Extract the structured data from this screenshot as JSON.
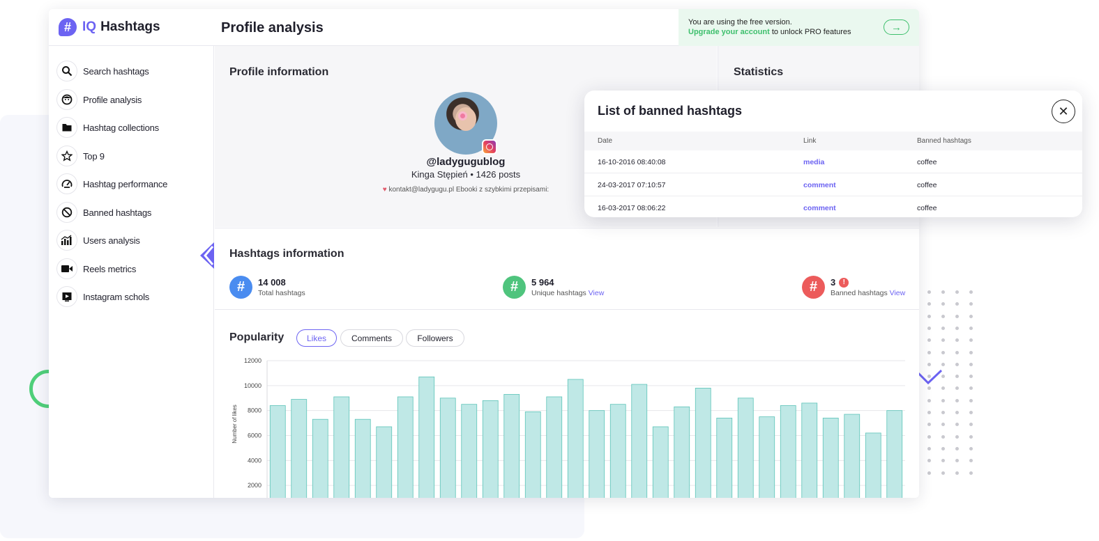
{
  "app": {
    "brand_iq": "IQ",
    "brand_name": "Hashtags",
    "page_title": "Profile analysis",
    "banner": {
      "line1": "You are using the free version.",
      "link": "Upgrade your account",
      "line2_rest": "to unlock PRO features"
    }
  },
  "sidebar": {
    "items": [
      {
        "label": "Search hashtags",
        "icon": "search-icon"
      },
      {
        "label": "Profile analysis",
        "icon": "face-icon"
      },
      {
        "label": "Hashtag collections",
        "icon": "folder-icon"
      },
      {
        "label": "Top 9",
        "icon": "star-icon"
      },
      {
        "label": "Hashtag performance",
        "icon": "gauge-icon"
      },
      {
        "label": "Banned hashtags",
        "icon": "ban-icon"
      },
      {
        "label": "Users analysis",
        "icon": "bar-chart-icon"
      },
      {
        "label": "Reels metrics",
        "icon": "video-camera-icon"
      },
      {
        "label": "Instagram schols",
        "icon": "play-box-icon"
      }
    ]
  },
  "profile": {
    "section_title": "Profile information",
    "handle": "@ladygugublog",
    "subline": "Kinga Stępień • 1426 posts",
    "bio": "kontakt@ladygugu.pl Ebooki z szybkimi przepisami:"
  },
  "statistics": {
    "section_title": "Statistics"
  },
  "hashtags_info": {
    "section_title": "Hashtags information",
    "total": {
      "value": "14 008",
      "caption": "Total hashtags",
      "color": "#4a8cf0"
    },
    "unique": {
      "value": "5 964",
      "caption": "Unique hashtags",
      "view": "View",
      "color": "#4fc47d"
    },
    "banned": {
      "value": "3",
      "caption": "Banned hashtags",
      "view": "View",
      "color": "#ec5b5b"
    }
  },
  "popularity": {
    "section_title": "Popularity",
    "tabs": [
      "Likes",
      "Comments",
      "Followers"
    ],
    "active_tab": "Likes"
  },
  "chart_data": {
    "type": "bar",
    "title": "",
    "xlabel": "",
    "ylabel": "Number of likes",
    "ylim": [
      0,
      12000
    ],
    "yticks": [
      2000,
      4000,
      6000,
      8000,
      10000,
      12000
    ],
    "values": [
      8400,
      8900,
      7300,
      9100,
      7300,
      6700,
      9100,
      10700,
      9000,
      8500,
      8800,
      9300,
      7900,
      9100,
      10500,
      8000,
      8500,
      10100,
      6700,
      8300,
      9800,
      7400,
      9000,
      7500,
      8400,
      8600,
      7400,
      7700,
      6200,
      8000
    ],
    "bar_color": "#bfe8e6",
    "bar_stroke": "#5cc3b8",
    "grid": true
  },
  "banned_modal": {
    "title": "List of banned hashtags",
    "columns": [
      "Date",
      "Link",
      "Banned hashtags"
    ],
    "rows": [
      {
        "date": "16-10-2016 08:40:08",
        "link": "media",
        "hashtag": "coffee"
      },
      {
        "date": "24-03-2017 07:10:57",
        "link": "comment",
        "hashtag": "coffee"
      },
      {
        "date": "16-03-2017 08:06:22",
        "link": "comment",
        "hashtag": "coffee"
      }
    ]
  },
  "colors": {
    "accent": "#6c63f2",
    "green": "#3dbf6c",
    "red": "#ec5b5b"
  }
}
